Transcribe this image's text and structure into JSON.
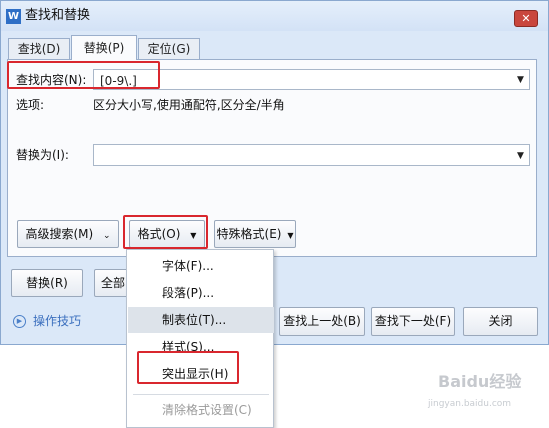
{
  "window": {
    "app_icon": "W",
    "title": "查找和替换",
    "close_label": "✕"
  },
  "tabs": [
    {
      "label": "查找(D)",
      "active": false
    },
    {
      "label": "替换(P)",
      "active": true
    },
    {
      "label": "定位(G)",
      "active": false
    }
  ],
  "find": {
    "label": "查找内容(N):",
    "value": "[0-9\\.]"
  },
  "options": {
    "label": "选项:",
    "value": "区分大小写,使用通配符,区分全/半角"
  },
  "replace": {
    "label": "替换为(I):",
    "value": ""
  },
  "buttons": {
    "advanced_search": "高级搜索(M)",
    "format": "格式(O)",
    "special_format": "特殊格式(E)",
    "replace": "替换(R)",
    "replace_all": "全部",
    "find_prev": "查找上一处(B)",
    "find_next": "查找下一处(F)",
    "close": "关闭"
  },
  "help_link": "操作技巧",
  "format_menu": {
    "items": [
      {
        "label": "字体(F)...",
        "highlighted": false,
        "disabled": false
      },
      {
        "label": "段落(P)...",
        "highlighted": false,
        "disabled": false
      },
      {
        "label": "制表位(T)...",
        "highlighted": true,
        "disabled": false
      },
      {
        "label": "样式(S)...",
        "highlighted": false,
        "disabled": false
      },
      {
        "label": "突出显示(H)",
        "highlighted": false,
        "disabled": false
      },
      {
        "label": "清除格式设置(C)",
        "highlighted": false,
        "disabled": true
      }
    ]
  },
  "watermark": {
    "text": "Baidu经验",
    "url": "jingyan.baidu.com"
  },
  "colors": {
    "annotation_red": "#d9272e",
    "dialog_bg": "#dbe8f8",
    "link_blue": "#3b6fbe"
  }
}
